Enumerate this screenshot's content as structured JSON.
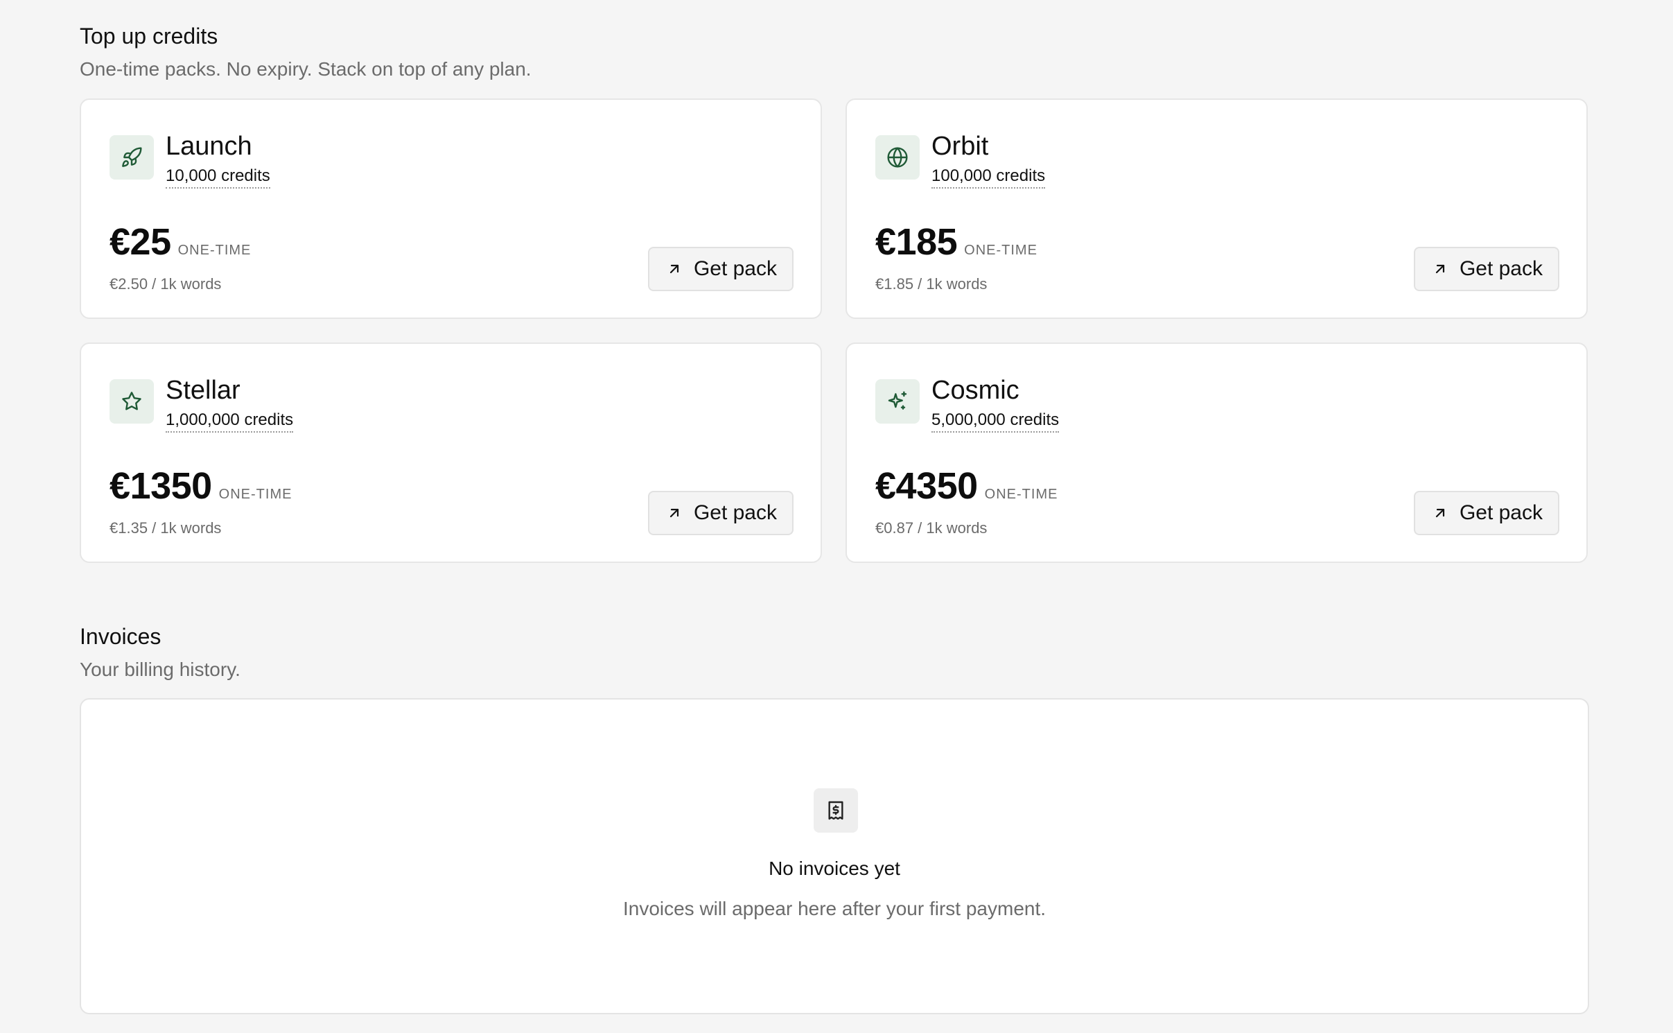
{
  "topup": {
    "title": "Top up credits",
    "subtitle": "One-time packs. No expiry. Stack on top of any plan."
  },
  "packs": [
    {
      "name": "Launch",
      "credits": "10,000 credits",
      "price": "€25",
      "term": "ONE-TIME",
      "rate": "€2.50 / 1k words",
      "button": "Get pack",
      "icon": "rocket-icon"
    },
    {
      "name": "Orbit",
      "credits": "100,000 credits",
      "price": "€185",
      "term": "ONE-TIME",
      "rate": "€1.85 / 1k words",
      "button": "Get pack",
      "icon": "globe-icon"
    },
    {
      "name": "Stellar",
      "credits": "1,000,000 credits",
      "price": "€1350",
      "term": "ONE-TIME",
      "rate": "€1.35 / 1k words",
      "button": "Get pack",
      "icon": "star-icon"
    },
    {
      "name": "Cosmic",
      "credits": "5,000,000 credits",
      "price": "€4350",
      "term": "ONE-TIME",
      "rate": "€0.87 / 1k words",
      "button": "Get pack",
      "icon": "sparkles-icon"
    }
  ],
  "invoices": {
    "title": "Invoices",
    "subtitle": "Your billing history.",
    "empty_title": "No invoices yet",
    "empty_text": "Invoices will appear here after your first payment.",
    "empty_icon": "receipt-icon"
  },
  "colors": {
    "background": "#f5f5f5",
    "card": "#ffffff",
    "icon_tile": "#e8f0ea",
    "icon_accent": "#1f5a36"
  }
}
